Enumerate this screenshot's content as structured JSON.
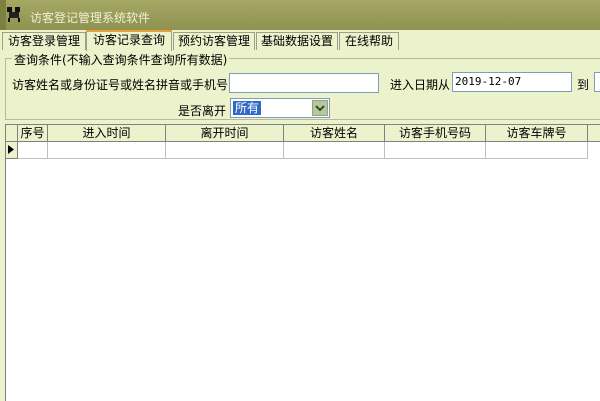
{
  "window": {
    "title": "访客登记管理系统软件",
    "icon": "camera-icon"
  },
  "tabs": [
    {
      "label": "访客登录管理",
      "active": false
    },
    {
      "label": "访客记录查询",
      "active": true
    },
    {
      "label": "预约访客管理",
      "active": false
    },
    {
      "label": "基础数据设置",
      "active": false
    },
    {
      "label": "在线帮助",
      "active": false
    }
  ],
  "query": {
    "group_title": "查询条件(不输入查询条件查询所有数据)",
    "name_label": "访客姓名或身份证号或姓名拼音或手机号",
    "name_value": "",
    "date_from_label": "进入日期从",
    "date_from_value": "2019-12-07",
    "date_to_label": "到",
    "left_label": "是否离开",
    "left_value": "所有"
  },
  "table": {
    "columns": [
      "序号",
      "进入时间",
      "离开时间",
      "访客姓名",
      "访客手机号码",
      "访客车牌号"
    ],
    "current_row_marker": "▶"
  },
  "colors": {
    "background": "#ecf2cb",
    "titlebar": "#9b9d5a",
    "active_tab_accent": "#e8a03a",
    "selection": "#3169c6"
  }
}
